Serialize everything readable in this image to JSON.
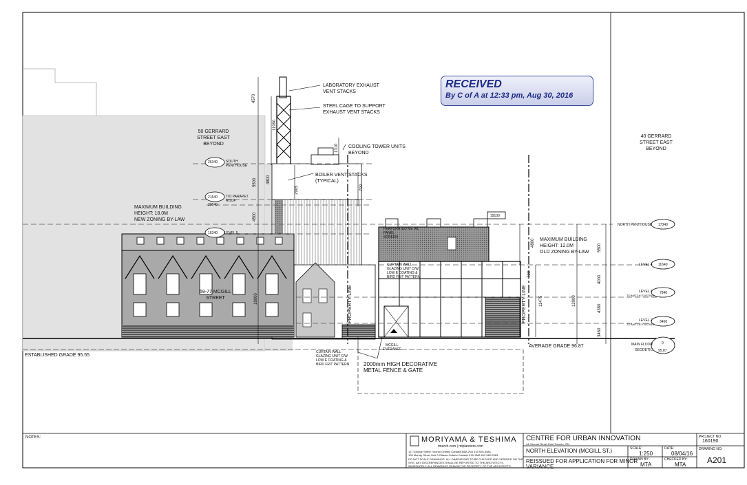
{
  "stamp": {
    "title": "RECEIVED",
    "line": "By C of A at 12:33 pm, Aug 30, 2016"
  },
  "labels": {
    "gerrard50": [
      "50 GERRARD",
      "STREET EAST",
      "BEYOND"
    ],
    "gerrard40": [
      "40 GERRARD",
      "STREET EAST",
      "BEYOND"
    ],
    "lab_exhaust": [
      "LABORATORY EXHAUST",
      "VENT STACKS"
    ],
    "steel_cage": [
      "STEEL CAGE TO SUPPORT",
      "EXHAUST VENT STACKS"
    ],
    "cooling": [
      "COOLING TOWER UNITS",
      "BEYOND"
    ],
    "boiler": [
      "BOILER VENT STACKS",
      "(TYPICAL)"
    ],
    "max_new": [
      "MAXIMUM BUILDING",
      "HEIGHT: 18.0M",
      "NEW ZONING BY-LAW"
    ],
    "max_old": [
      "MAXIMUM BUILDING",
      "HEIGHT: 12.0M",
      "OLD ZONING BY-LAW"
    ],
    "mcgill_street": [
      "59-77 MCGILL",
      "STREET"
    ],
    "perforated": [
      "PERFORATED METAL",
      "PANEL",
      "SCREEN"
    ],
    "curtain_upper": [
      "CURTAIN WALL",
      "GLAZING UNIT C/W",
      "LOW E COATING &",
      "BIRD FRIT PATTERN"
    ],
    "curtain_lower": [
      "CURTAIN WALL",
      "GLAZING UNIT C/W",
      "LOW E COATING &",
      "BIRD FRIT PATTERN"
    ],
    "fence": [
      "2000mm HIGH DECORATIVE",
      "METAL FENCE & GATE"
    ],
    "entrance": [
      "MCGILL",
      "ENTRANCE"
    ],
    "grade_established": "ESTABLISHED GRADE 95.55",
    "grade_average": "AVERAGE GRADE 96.87",
    "property_line": "PROPERTY LINE",
    "south_penthouse": [
      "26340",
      "SOUTH",
      "PENTHOUSE"
    ],
    "parapet": [
      "21540",
      "T/O PARAPET",
      "ROOF"
    ],
    "parapet2": "20640",
    "level5": [
      "16340",
      "LEVEL 5"
    ],
    "box19100": "19100"
  },
  "levels": [
    {
      "name": "NORTH PENTHOUSE",
      "value": "17340",
      "note": ""
    },
    {
      "name": "LEVEL 4",
      "value": "11640",
      "note": ""
    },
    {
      "name": "LEVEL 3",
      "value": "7840",
      "note": "TO MATCH EXISTING"
    },
    {
      "name": "LEVEL 2",
      "value": "3460",
      "note": "TO MATCH EXISTING"
    },
    {
      "name": "MAIN FLOOR",
      "value": "0",
      "note": "GEODETIC",
      "extra": "95.87"
    }
  ],
  "dims": {
    "d4570": "4570",
    "d11990": "11990",
    "d1310": "1310",
    "d5500a": "5500",
    "d4800a": "4800",
    "d2905": "2905",
    "d700a": "700",
    "d4500": "4500",
    "d18000": "18000",
    "d4800b": "4800",
    "d5500b": "5500",
    "d700b": "700",
    "d4000": "4000",
    "d11475": "11475",
    "d12000": "12000",
    "d4380": "4380",
    "d3460": "3460"
  },
  "titleblock": {
    "notes": "NOTES:",
    "firm": "MORIYAMA & TESHIMA",
    "firm_sub": "mtarch.com | mtplanners.com",
    "firm_addr1": "117 George Street Toronto Ontario Canada M5A 2N4      416 925-4484",
    "firm_addr2": "100 Murray Street Unit 3 Ottawa Ontario Canada K1N 0M6   613 562-2983",
    "firm_note1": "DO NOT SCALE DRAWINGS. ALL DIMENSIONS TO BE CHECKED AND VERIFIED ON THE",
    "firm_note2": "SITE. ANY DISCREPANCIES SHALL BE REPORTED TO THE ARCHITECTS.",
    "firm_note3": "IMMEDIATELY. ALL DRAWINGS REMAIN THE PROPERTY OF THE ARCHITECTS.",
    "project": "CENTRE FOR URBAN INNOVATION",
    "project_addr": "44 Gerrard Street East Toronto, ON",
    "drawing_title": "NORTH ELEVATION (MCGILL ST.)",
    "issue": [
      "REISSUED FOR APPLICATION FOR MINOR",
      "VARIANCE"
    ],
    "scale_label": "SCALE:",
    "scale": "1:250",
    "date_label": "DATE:",
    "date": "08/04/16",
    "drawn_label": "DRAWN BY:",
    "drawn": "MTA",
    "checked_label": "CHECKED BY:",
    "checked": "MTA",
    "project_no_label": "PROJECT NO.",
    "project_no": "160190",
    "drawing_no_label": "DRAWING NO.",
    "drawing_no": "A201"
  }
}
